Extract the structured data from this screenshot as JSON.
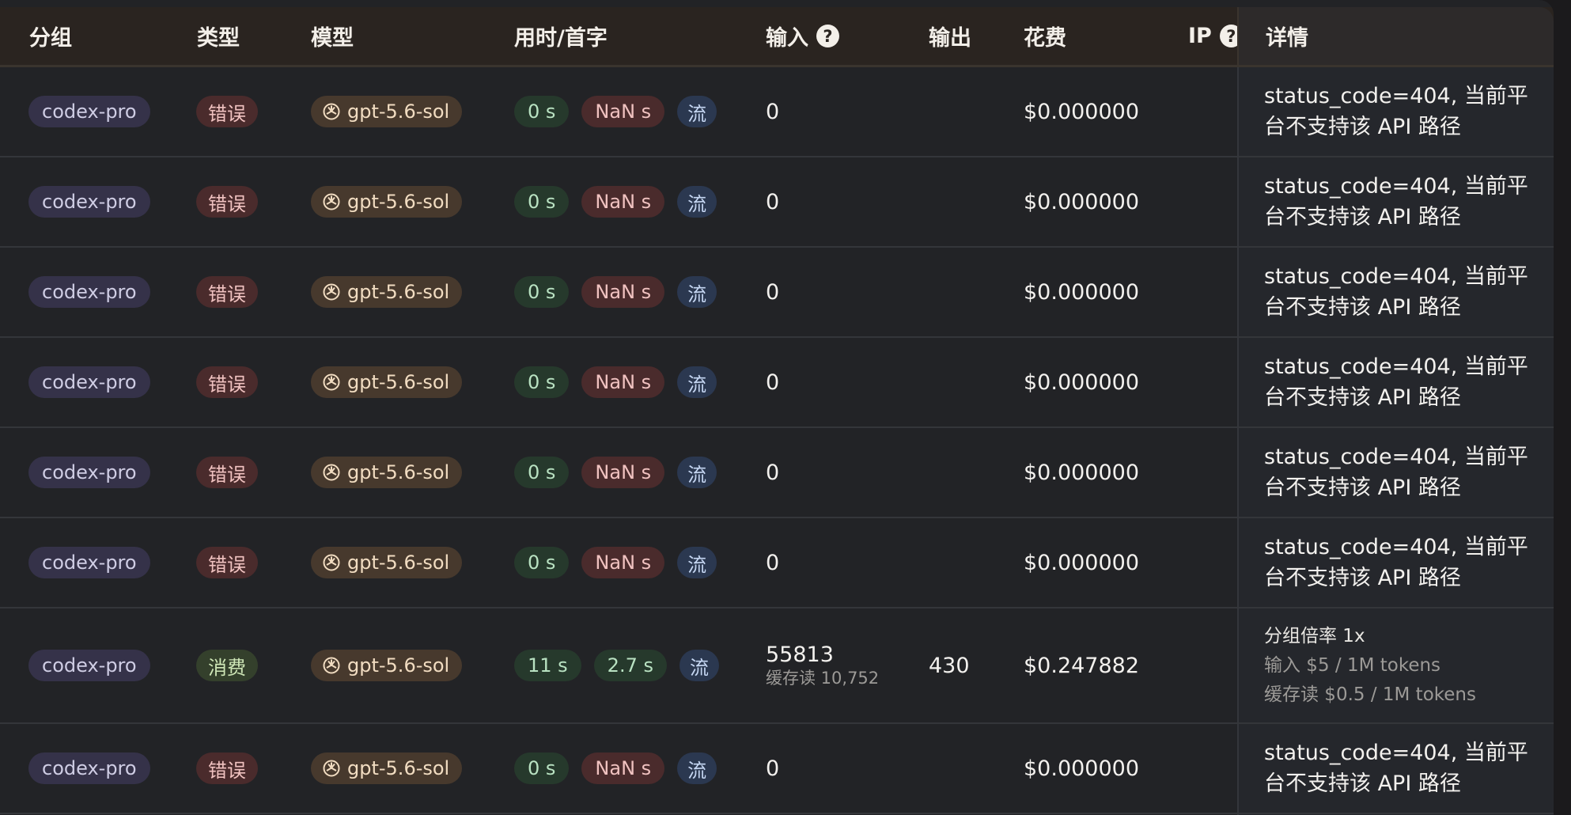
{
  "headers": {
    "group": "分组",
    "type": "类型",
    "model": "模型",
    "time": "用时/首字",
    "input": "输入",
    "output": "输出",
    "cost": "花费",
    "ip": "IP",
    "detail": "详情"
  },
  "icons": {
    "help": "question-circle-icon",
    "model": "openai-logo-icon"
  },
  "colors": {
    "error": "#f0c2c0",
    "consume": "#cfe7b7",
    "stream": "#c6d7f3"
  },
  "rows": [
    {
      "group": "codex-pro",
      "type": "错误",
      "model": "gpt-5.6-sol",
      "time": "0 s",
      "first": "NaN s",
      "stream": "流",
      "input": "0",
      "cost": "$0.000000",
      "detail_line1": "status_code=404, 当前平",
      "detail_line2": "台不支持该 API 路径"
    },
    {
      "group": "codex-pro",
      "type": "错误",
      "model": "gpt-5.6-sol",
      "time": "0 s",
      "first": "NaN s",
      "stream": "流",
      "input": "0",
      "cost": "$0.000000",
      "detail_line1": "status_code=404, 当前平",
      "detail_line2": "台不支持该 API 路径"
    },
    {
      "group": "codex-pro",
      "type": "错误",
      "model": "gpt-5.6-sol",
      "time": "0 s",
      "first": "NaN s",
      "stream": "流",
      "input": "0",
      "cost": "$0.000000",
      "detail_line1": "status_code=404, 当前平",
      "detail_line2": "台不支持该 API 路径"
    },
    {
      "group": "codex-pro",
      "type": "错误",
      "model": "gpt-5.6-sol",
      "time": "0 s",
      "first": "NaN s",
      "stream": "流",
      "input": "0",
      "cost": "$0.000000",
      "detail_line1": "status_code=404, 当前平",
      "detail_line2": "台不支持该 API 路径"
    },
    {
      "group": "codex-pro",
      "type": "错误",
      "model": "gpt-5.6-sol",
      "time": "0 s",
      "first": "NaN s",
      "stream": "流",
      "input": "0",
      "cost": "$0.000000",
      "detail_line1": "status_code=404, 当前平",
      "detail_line2": "台不支持该 API 路径"
    },
    {
      "group": "codex-pro",
      "type": "错误",
      "model": "gpt-5.6-sol",
      "time": "0 s",
      "first": "NaN s",
      "stream": "流",
      "input": "0",
      "cost": "$0.000000",
      "detail_line1": "status_code=404, 当前平",
      "detail_line2": "台不支持该 API 路径"
    },
    {
      "group": "codex-pro",
      "type": "消费",
      "model": "gpt-5.6-sol",
      "time": "11 s",
      "first": "2.7 s",
      "stream": "流",
      "input": "55813",
      "input_sub": "缓存读 10,752",
      "output": "430",
      "cost": "$0.247882",
      "detail_title": "分组倍率 1x",
      "detail_input": "输入 $5 / 1M tokens",
      "detail_cache": "缓存读 $0.5 / 1M tokens"
    },
    {
      "group": "codex-pro",
      "type": "错误",
      "model": "gpt-5.6-sol",
      "time": "0 s",
      "first": "NaN s",
      "stream": "流",
      "input": "0",
      "cost": "$0.000000",
      "detail_line1": "status_code=404, 当前平",
      "detail_line2": "台不支持该 API 路径"
    }
  ]
}
